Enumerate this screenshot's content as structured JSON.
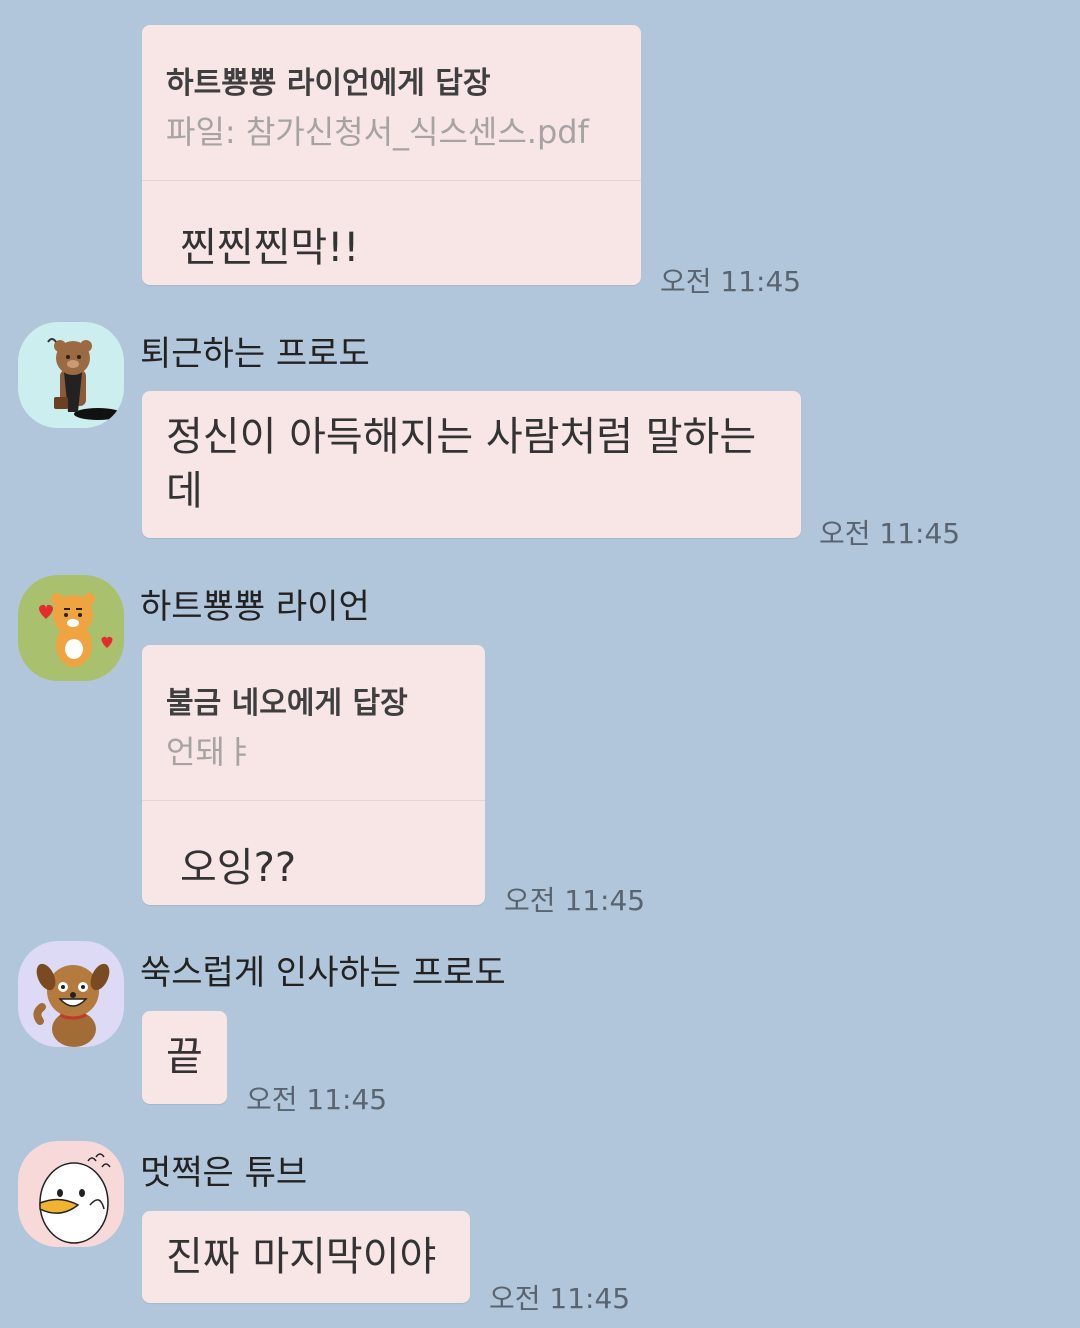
{
  "messages": [
    {
      "reply_title": "하트뿅뿅 라이언에게 답장",
      "reply_quote": "파일: 참가신청서_식스센스.pdf",
      "text": "찐찐찐막!!",
      "time": "오전 11:45"
    },
    {
      "sender": "퇴근하는 프로도",
      "avatar_icon": "frodo-commute-icon",
      "text": "정신이 아득해지는 사람처럼 말하는데",
      "time": "오전 11:45"
    },
    {
      "sender": "하트뿅뿅 라이언",
      "avatar_icon": "ryan-hearts-icon",
      "reply_title": "불금 네오에게 답장",
      "reply_quote": "언돼ㅑ",
      "text": "오잉??",
      "time": "오전 11:45"
    },
    {
      "sender": "쑥스럽게 인사하는 프로도",
      "avatar_icon": "frodo-shy-wave-icon",
      "text": "끝",
      "time": "오전 11:45"
    },
    {
      "sender": "멋쩍은 튜브",
      "avatar_icon": "tube-awkward-icon",
      "text": "진짜 마지막이야",
      "time": "오전 11:45"
    }
  ],
  "colors": {
    "background": "#b1c6db",
    "bubble": "#f8e6e6"
  }
}
